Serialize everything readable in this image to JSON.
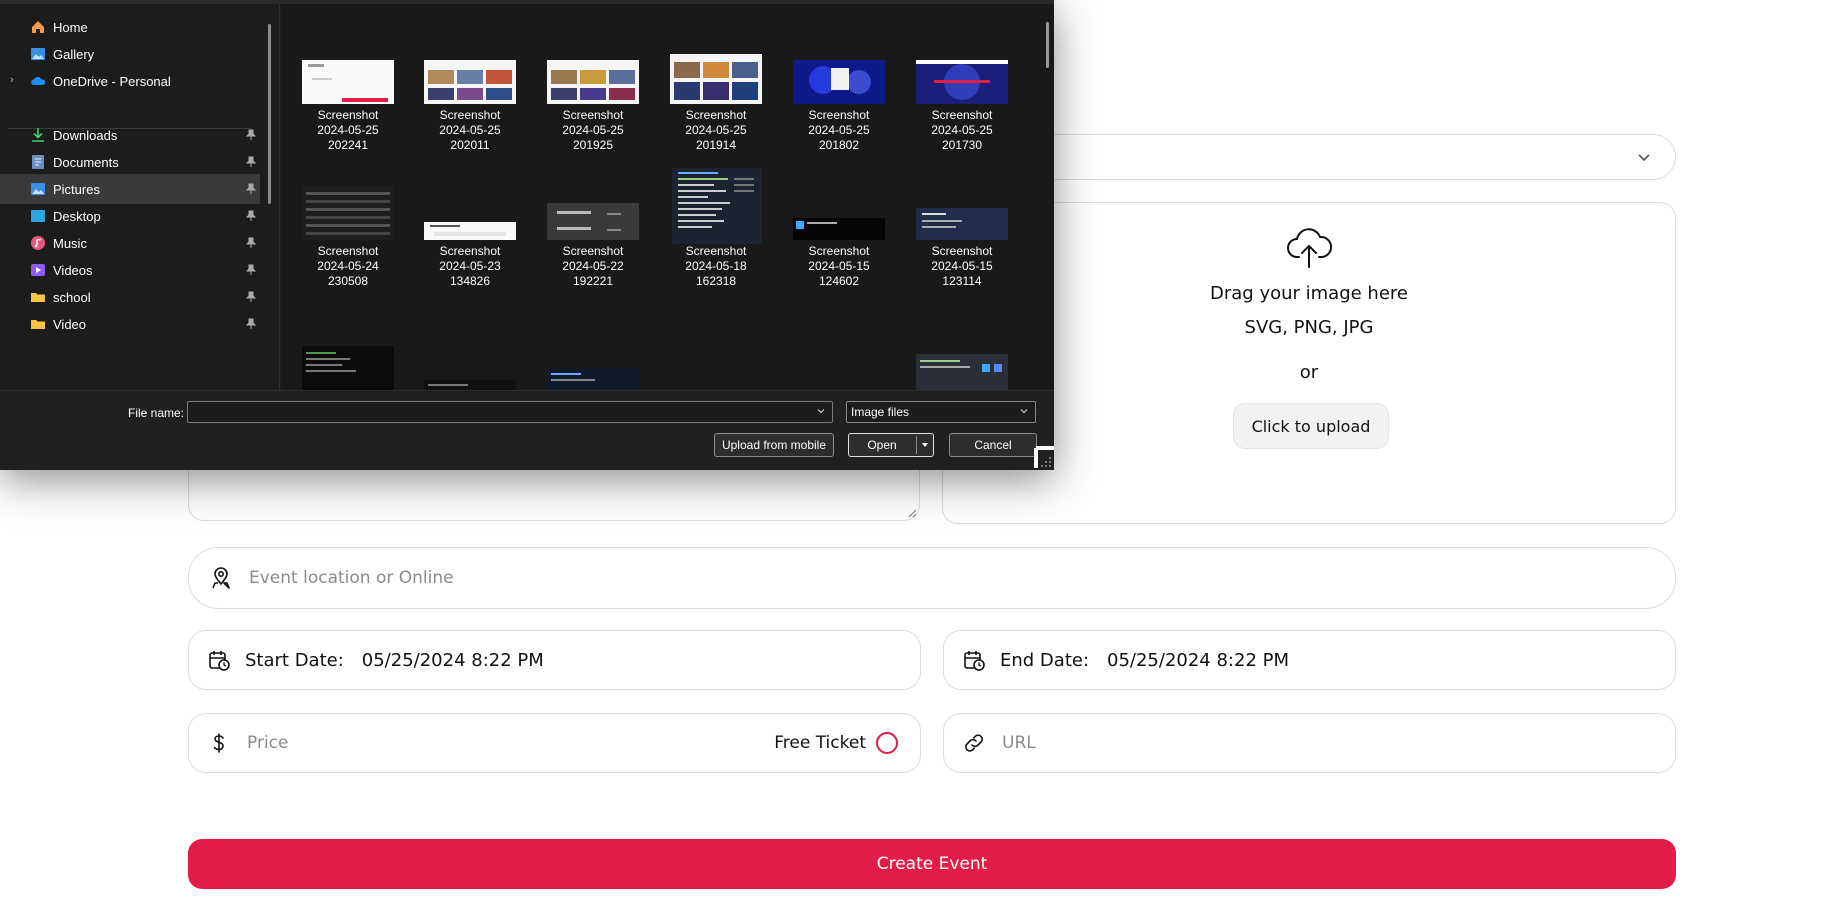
{
  "form": {
    "upload": {
      "title": "Drag your image here",
      "types": "SVG, PNG, JPG",
      "or": "or",
      "button": "Click to upload"
    },
    "location_placeholder": "Event location or Online",
    "start_label": "Start Date:",
    "start_value": "05/25/2024 8:22 PM",
    "end_label": "End Date:",
    "end_value": "05/25/2024 8:22 PM",
    "price_placeholder": "Price",
    "free_ticket_label": "Free Ticket",
    "url_placeholder": "URL",
    "create_button": "Create Event",
    "accent_color": "#e11d48"
  },
  "dialog": {
    "nav": [
      {
        "label": "Home",
        "icon": "home-icon",
        "pinned": false,
        "expandable": false,
        "selected": false
      },
      {
        "label": "Gallery",
        "icon": "gallery-icon",
        "pinned": false,
        "expandable": false,
        "selected": false
      },
      {
        "label": "OneDrive - Personal",
        "icon": "onedrive-icon",
        "pinned": false,
        "expandable": true,
        "selected": false
      },
      {
        "label": "Downloads",
        "icon": "downloads-icon",
        "pinned": true,
        "expandable": false,
        "selected": false
      },
      {
        "label": "Documents",
        "icon": "documents-icon",
        "pinned": true,
        "expandable": false,
        "selected": false
      },
      {
        "label": "Pictures",
        "icon": "pictures-icon",
        "pinned": true,
        "expandable": false,
        "selected": true
      },
      {
        "label": "Desktop",
        "icon": "desktop-icon",
        "pinned": true,
        "expandable": false,
        "selected": false
      },
      {
        "label": "Music",
        "icon": "music-icon",
        "pinned": true,
        "expandable": false,
        "selected": false
      },
      {
        "label": "Videos",
        "icon": "videos-icon",
        "pinned": true,
        "expandable": false,
        "selected": false
      },
      {
        "label": "school",
        "icon": "folder-icon",
        "pinned": true,
        "expandable": false,
        "selected": false
      },
      {
        "label": "Video",
        "icon": "folder-icon",
        "pinned": true,
        "expandable": false,
        "selected": false
      }
    ],
    "files": [
      {
        "name": "Screenshot",
        "date": "2024-05-25",
        "time": "202241",
        "thumb": "light"
      },
      {
        "name": "Screenshot",
        "date": "2024-05-25",
        "time": "202011",
        "thumb": "grid"
      },
      {
        "name": "Screenshot",
        "date": "2024-05-25",
        "time": "201925",
        "thumb": "grid"
      },
      {
        "name": "Screenshot",
        "date": "2024-05-25",
        "time": "201914",
        "thumb": "grid"
      },
      {
        "name": "Screenshot",
        "date": "2024-05-25",
        "time": "201802",
        "thumb": "concert"
      },
      {
        "name": "Screenshot",
        "date": "2024-05-25",
        "time": "201730",
        "thumb": "concert-red"
      },
      {
        "name": "Screenshot",
        "date": "2024-05-24",
        "time": "230508",
        "thumb": "dark"
      },
      {
        "name": "Screenshot",
        "date": "2024-05-23",
        "time": "134826",
        "thumb": "white-bar"
      },
      {
        "name": "Screenshot",
        "date": "2024-05-22",
        "time": "192221",
        "thumb": "gray"
      },
      {
        "name": "Screenshot",
        "date": "2024-05-18",
        "time": "162318",
        "thumb": "code"
      },
      {
        "name": "Screenshot",
        "date": "2024-05-15",
        "time": "124602",
        "thumb": "black"
      },
      {
        "name": "Screenshot",
        "date": "2024-05-15",
        "time": "123114",
        "thumb": "navy"
      }
    ],
    "file_name_label": "File name:",
    "file_name_value": "",
    "file_type": "Image files",
    "buttons": {
      "mobile": "Upload from mobile",
      "open": "Open",
      "cancel": "Cancel"
    }
  }
}
